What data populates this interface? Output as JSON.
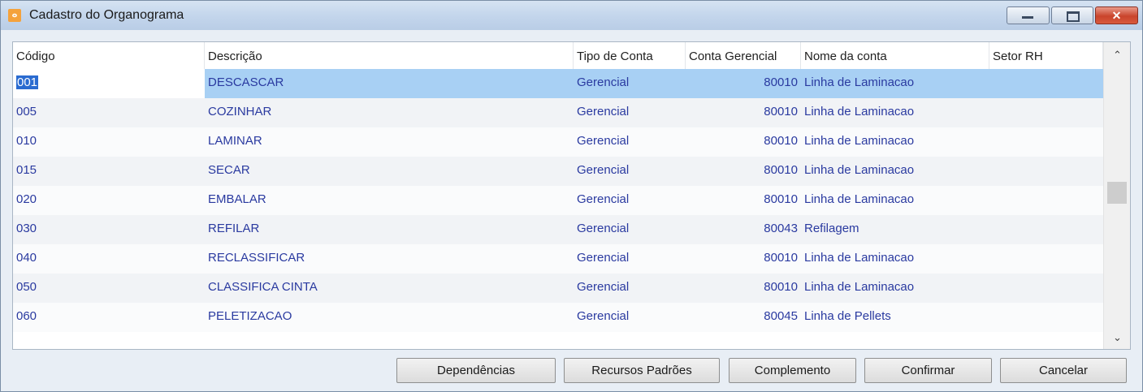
{
  "window": {
    "title": "Cadastro do Organograma",
    "icon": "app-icon",
    "controls": {
      "minimize": "minimize",
      "maximize": "maximize",
      "close": "✕"
    }
  },
  "table": {
    "columns": [
      "Código",
      "Descrição",
      "Tipo de Conta",
      "Conta Gerencial",
      "Nome da conta",
      "Setor RH"
    ],
    "rows": [
      {
        "codigo": "001",
        "descricao": "DESCASCAR",
        "tipo": "Gerencial",
        "conta": "80010",
        "nome": "Linha de Laminacao",
        "setor": ""
      },
      {
        "codigo": "005",
        "descricao": "COZINHAR",
        "tipo": "Gerencial",
        "conta": "80010",
        "nome": "Linha de Laminacao",
        "setor": ""
      },
      {
        "codigo": "010",
        "descricao": "LAMINAR",
        "tipo": "Gerencial",
        "conta": "80010",
        "nome": "Linha de Laminacao",
        "setor": ""
      },
      {
        "codigo": "015",
        "descricao": "SECAR",
        "tipo": "Gerencial",
        "conta": "80010",
        "nome": "Linha de Laminacao",
        "setor": ""
      },
      {
        "codigo": "020",
        "descricao": "EMBALAR",
        "tipo": "Gerencial",
        "conta": "80010",
        "nome": "Linha de Laminacao",
        "setor": ""
      },
      {
        "codigo": "030",
        "descricao": "REFILAR",
        "tipo": "Gerencial",
        "conta": "80043",
        "nome": "Refilagem",
        "setor": ""
      },
      {
        "codigo": "040",
        "descricao": "RECLASSIFICAR",
        "tipo": "Gerencial",
        "conta": "80010",
        "nome": "Linha de Laminacao",
        "setor": ""
      },
      {
        "codigo": "050",
        "descricao": "CLASSIFICA CINTA",
        "tipo": "Gerencial",
        "conta": "80010",
        "nome": "Linha de Laminacao",
        "setor": ""
      },
      {
        "codigo": "060",
        "descricao": "PELETIZACAO",
        "tipo": "Gerencial",
        "conta": "80045",
        "nome": "Linha de Pellets",
        "setor": ""
      }
    ],
    "selected_row": 0,
    "scroll_up": "^",
    "scroll_down": "v"
  },
  "buttons": {
    "dependencias": "Dependências",
    "recursos": "Recursos Padrões",
    "complemento": "Complemento",
    "confirmar": "Confirmar",
    "cancelar": "Cancelar"
  },
  "colors": {
    "text_blue": "#2a3aa0",
    "selection": "#a8d0f4"
  }
}
